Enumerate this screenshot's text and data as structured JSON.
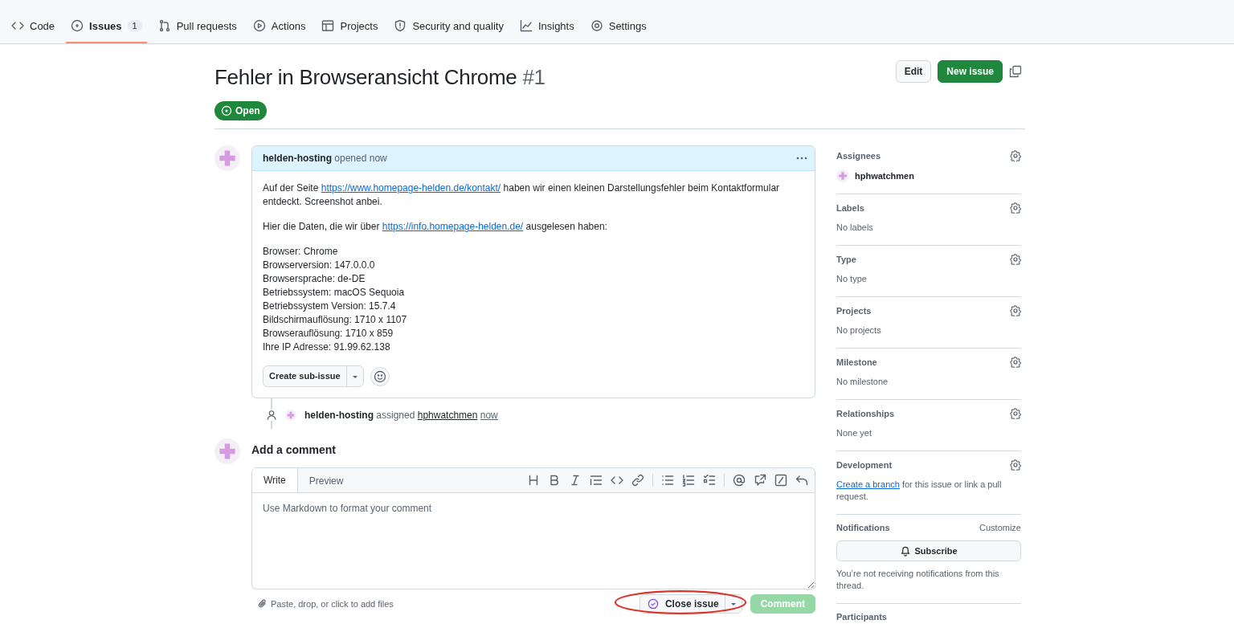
{
  "repo_nav": {
    "tabs": [
      {
        "label": "Code",
        "selected": false
      },
      {
        "label": "Issues",
        "count": "1",
        "selected": true
      },
      {
        "label": "Pull requests",
        "selected": false
      },
      {
        "label": "Actions",
        "selected": false
      },
      {
        "label": "Projects",
        "selected": false
      },
      {
        "label": "Security and quality",
        "selected": false
      },
      {
        "label": "Insights",
        "selected": false
      },
      {
        "label": "Settings",
        "selected": false
      }
    ]
  },
  "issue": {
    "title": "Fehler in Browseransicht Chrome",
    "number": "#1",
    "state_label": "Open"
  },
  "header_buttons": {
    "edit": "Edit",
    "new_issue": "New issue"
  },
  "comment": {
    "author": "helden-hosting",
    "meta": "opened now",
    "paragraphs": [
      [
        {
          "text": "Auf der Seite "
        },
        {
          "link": "https://www.homepage-helden.de/kontakt/"
        },
        {
          "text": " haben wir einen kleinen Darstellungsfehler beim Kontaktformular entdeckt. Screenshot anbei."
        }
      ],
      [
        {
          "text": "Hier die Daten, die wir über "
        },
        {
          "link": "https://info.homepage-helden.de/"
        },
        {
          "text": " ausgelesen haben:"
        }
      ]
    ],
    "lines": [
      "Browser: Chrome",
      "Browserversion: 147.0.0.0",
      "Browsersprache: de-DE",
      "Betriebssystem: macOS Sequoia",
      "Betriebssystem Version: 15.7.4",
      "Bildschirmauflösung: 1710 x 1107",
      "Browserauflösung: 1710 x 859",
      "Ihre IP Adresse: 91.99.62.138"
    ],
    "sub_issue_button": "Create sub-issue"
  },
  "event": {
    "actor": "helden-hosting",
    "action": "assigned",
    "target": "hphwatchmen",
    "time": "now"
  },
  "add_comment": {
    "heading": "Add a comment",
    "tabs": [
      {
        "label": "Write",
        "selected": true
      },
      {
        "label": "Preview",
        "selected": false
      }
    ],
    "placeholder": "Use Markdown to format your comment",
    "attach_hint": "Paste, drop, or click to add files",
    "close_button": "Close issue",
    "comment_button": {
      "label": "Comment",
      "disabled": true
    }
  },
  "sidebar": [
    {
      "kind": "assignee",
      "title": "Assignees",
      "user": "hphwatchmen"
    },
    {
      "kind": "text",
      "title": "Labels",
      "value": "No labels"
    },
    {
      "kind": "text",
      "title": "Type",
      "value": "No type"
    },
    {
      "kind": "text",
      "title": "Projects",
      "value": "No projects"
    },
    {
      "kind": "text",
      "title": "Milestone",
      "value": "No milestone"
    },
    {
      "kind": "text",
      "title": "Relationships",
      "value": "None yet"
    },
    {
      "kind": "development",
      "title": "Development",
      "link": "Create a branch",
      "value": " for this issue or link a pull request."
    },
    {
      "kind": "notifications",
      "title": "Notifications",
      "action": "Customize",
      "button": "Subscribe",
      "value": "You’re not receiving notifications from this thread."
    },
    {
      "kind": "participants",
      "title": "Participants"
    }
  ]
}
